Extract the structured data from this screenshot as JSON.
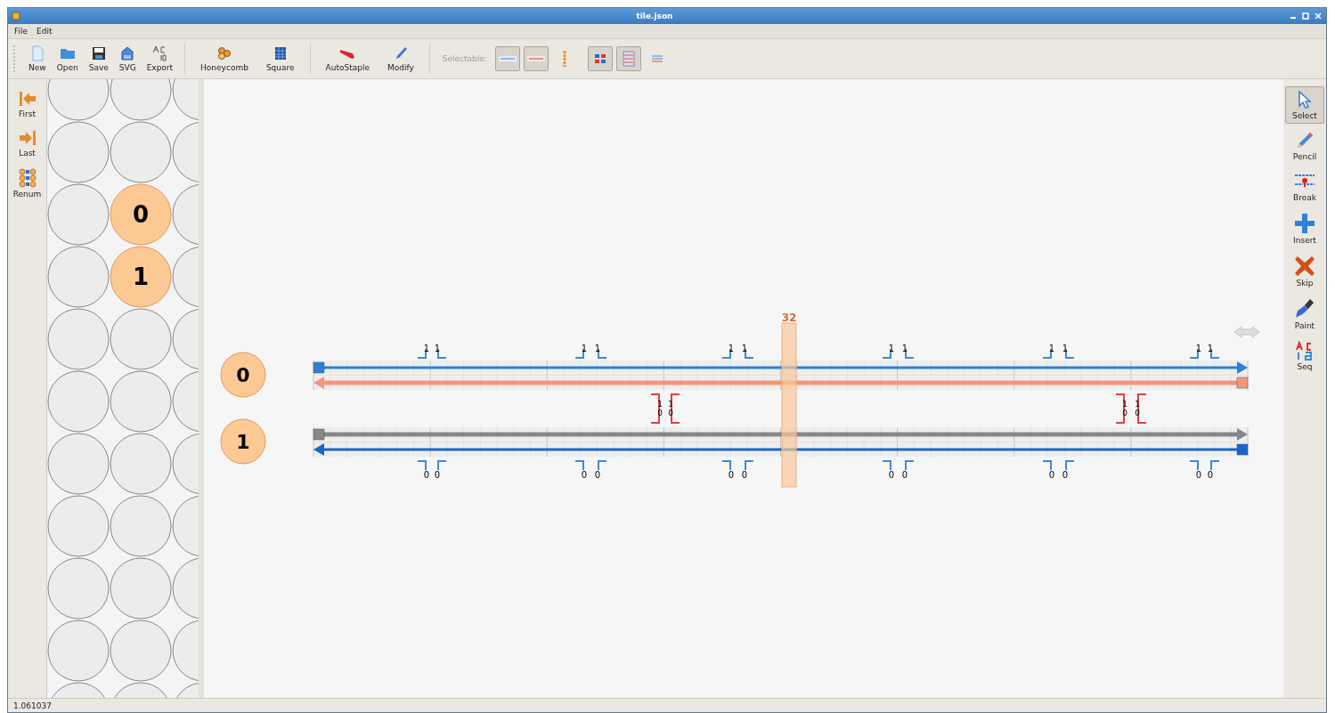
{
  "window": {
    "title": "tile.json"
  },
  "menu": [
    "File",
    "Edit"
  ],
  "toolbar": {
    "buttons": [
      {
        "label": "New"
      },
      {
        "label": "Open"
      },
      {
        "label": "Save"
      },
      {
        "label": "SVG"
      },
      {
        "label": "Export"
      },
      {
        "label": "Honeycomb"
      },
      {
        "label": "Square"
      },
      {
        "label": "AutoStaple"
      },
      {
        "label": "Modify"
      }
    ],
    "selectable_label": "Selectable:",
    "filters": [
      {
        "selected": true
      },
      {
        "selected": true
      },
      {
        "selected": false
      },
      {
        "selected": true
      },
      {
        "selected": true
      },
      {
        "selected": false
      }
    ]
  },
  "left_tools": [
    {
      "label": "First"
    },
    {
      "label": "Last"
    },
    {
      "label": "Renum"
    }
  ],
  "slice_view": {
    "helices": [
      {
        "number": "0"
      },
      {
        "number": "1"
      }
    ]
  },
  "path_view": {
    "slider_index": "32",
    "helices": [
      {
        "number": "0",
        "strands": [
          {
            "kind": "staple",
            "color": "#2f7fd8"
          },
          {
            "kind": "scaffold",
            "color": "#f4967a"
          }
        ],
        "crossover_labels": [
          "1",
          "1",
          "1",
          "1",
          "1",
          "1",
          "1",
          "1",
          "1",
          "1",
          "1",
          "1"
        ]
      },
      {
        "number": "1",
        "strands": [
          {
            "kind": "scaffold",
            "color": "#888888"
          },
          {
            "kind": "staple",
            "color": "#1a66c8"
          }
        ],
        "crossover_labels": [
          "0",
          "0",
          "0",
          "0",
          "0",
          "0",
          "0",
          "0",
          "0",
          "0",
          "0",
          "0"
        ]
      }
    ],
    "scaffold_crossovers": [
      {
        "upper": "1",
        "lower": "0"
      },
      {
        "upper": "1",
        "lower": "0"
      },
      {
        "upper": "1",
        "lower": "0"
      },
      {
        "upper": "1",
        "lower": "0"
      }
    ]
  },
  "right_tools": [
    {
      "label": "Select",
      "selected": true
    },
    {
      "label": "Pencil",
      "selected": false
    },
    {
      "label": "Break",
      "selected": false
    },
    {
      "label": "Insert",
      "selected": false
    },
    {
      "label": "Skip",
      "selected": false
    },
    {
      "label": "Paint",
      "selected": false
    },
    {
      "label": "Seq",
      "selected": false
    }
  ],
  "status_bar": "1.061037"
}
